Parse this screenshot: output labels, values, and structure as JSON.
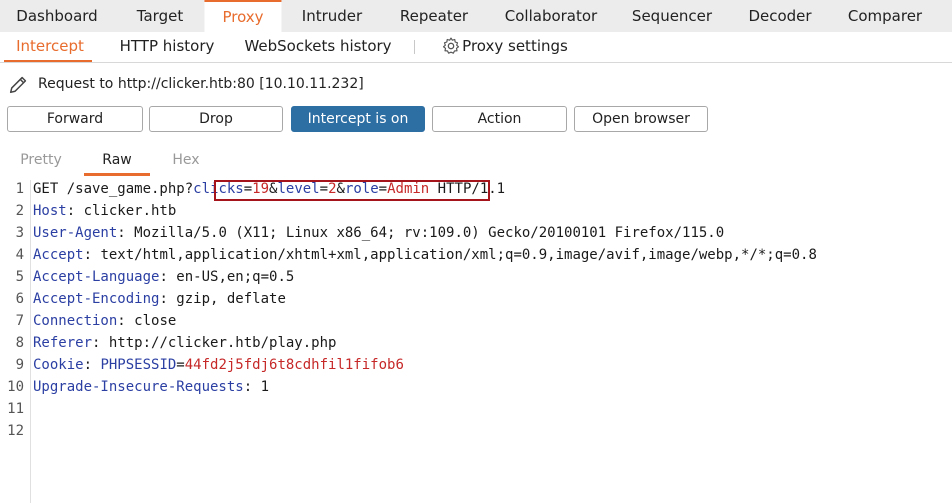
{
  "top_tabs": [
    {
      "label": "Dashboard",
      "active": false
    },
    {
      "label": "Target",
      "active": false
    },
    {
      "label": "Proxy",
      "active": true
    },
    {
      "label": "Intruder",
      "active": false
    },
    {
      "label": "Repeater",
      "active": false
    },
    {
      "label": "Collaborator",
      "active": false
    },
    {
      "label": "Sequencer",
      "active": false
    },
    {
      "label": "Decoder",
      "active": false
    },
    {
      "label": "Comparer",
      "active": false
    }
  ],
  "sub_tabs": [
    {
      "label": "Intercept",
      "active": true
    },
    {
      "label": "HTTP history",
      "active": false
    },
    {
      "label": "WebSockets history",
      "active": false
    },
    {
      "label": "Proxy settings",
      "active": false
    }
  ],
  "request_label": "Request to http://clicker.htb:80  [10.10.11.232]",
  "buttons": {
    "forward": "Forward",
    "drop": "Drop",
    "intercept": "Intercept is on",
    "action": "Action",
    "open_browser": "Open browser"
  },
  "editor_tabs": [
    {
      "label": "Pretty",
      "active": false
    },
    {
      "label": "Raw",
      "active": true
    },
    {
      "label": "Hex",
      "active": false
    }
  ],
  "lines": {
    "l1": {
      "method": "GET /save_game.php?",
      "p1_name": "clicks",
      "p1_eq": "=",
      "p1_val": "19",
      "amp1": "&",
      "p2_name": "level",
      "p2_eq": "=",
      "p2_val": "2",
      "amp2": "&",
      "p3_name": "role",
      "p3_eq": "=",
      "p3_val": "Admin",
      "proto": " HTTP/1.1"
    },
    "l2": {
      "name": "Host",
      "sep": ": ",
      "value": "clicker.htb"
    },
    "l3": {
      "name": "User-Agent",
      "sep": ": ",
      "value": "Mozilla/5.0 (X11; Linux x86_64; rv:109.0) Gecko/20100101 Firefox/115.0"
    },
    "l4": {
      "name": "Accept",
      "sep": ": ",
      "value": "text/html,application/xhtml+xml,application/xml;q=0.9,image/avif,image/webp,*/*;q=0.8"
    },
    "l5": {
      "name": "Accept-Language",
      "sep": ": ",
      "value": "en-US,en;q=0.5"
    },
    "l6": {
      "name": "Accept-Encoding",
      "sep": ": ",
      "value": "gzip, deflate"
    },
    "l7": {
      "name": "Connection",
      "sep": ": ",
      "value": "close"
    },
    "l8": {
      "name": "Referer",
      "sep": ": ",
      "value": "http://clicker.htb/play.php"
    },
    "l9": {
      "name": "Cookie",
      "sep": ": ",
      "cookie_name": "PHPSESSID",
      "cookie_eq": "=",
      "cookie_val": "44fd2j5fdj6t8cdhfil1fifob6"
    },
    "l10": {
      "name": "Upgrade-Insecure-Requests",
      "sep": ": ",
      "value": "1"
    }
  },
  "line_numbers": [
    "1",
    "2",
    "3",
    "4",
    "5",
    "6",
    "7",
    "8",
    "9",
    "10",
    "11",
    "12"
  ],
  "icons": {
    "settings": "gear-icon",
    "edit": "pencil-icon"
  },
  "colors": {
    "accent": "#e86c2d",
    "primary_button": "#2d6ea3",
    "highlight_box": "#a5141b",
    "header_name": "#2b3fa3",
    "param_value": "#c62828"
  }
}
